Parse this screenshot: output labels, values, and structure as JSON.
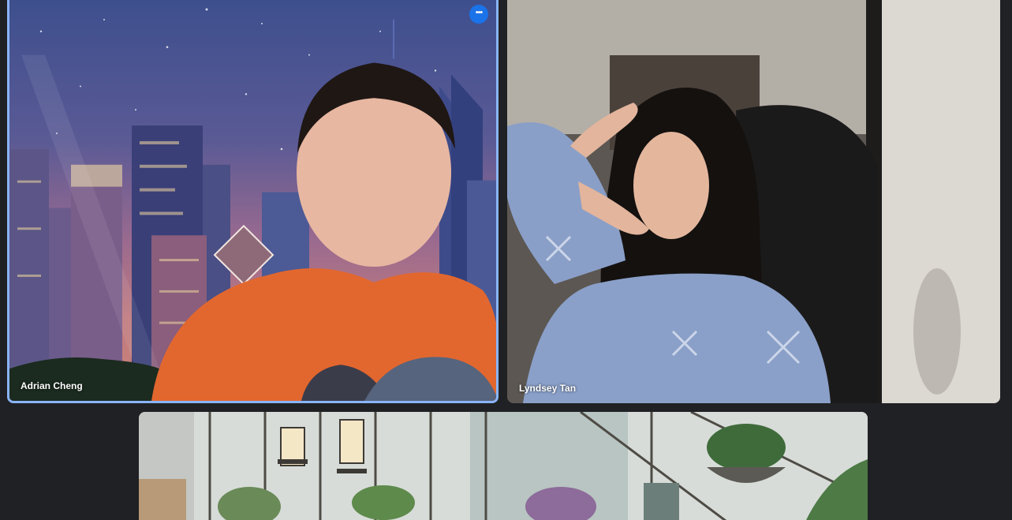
{
  "participants": [
    {
      "name": "Adrian Cheng",
      "active_speaker": true,
      "background": "city-skyline-night",
      "more_options_icon": "more-options-icon",
      "accent_color": "#8ab4f8"
    },
    {
      "name": "Lyndsey Tan",
      "active_speaker": false,
      "background": "camera"
    },
    {
      "name": "",
      "active_speaker": false,
      "background": "greenhouse-lanterns"
    }
  ],
  "colors": {
    "page_background": "#202124",
    "speaker_border": "#8ab4f8",
    "button_blue": "#1a73e8"
  }
}
